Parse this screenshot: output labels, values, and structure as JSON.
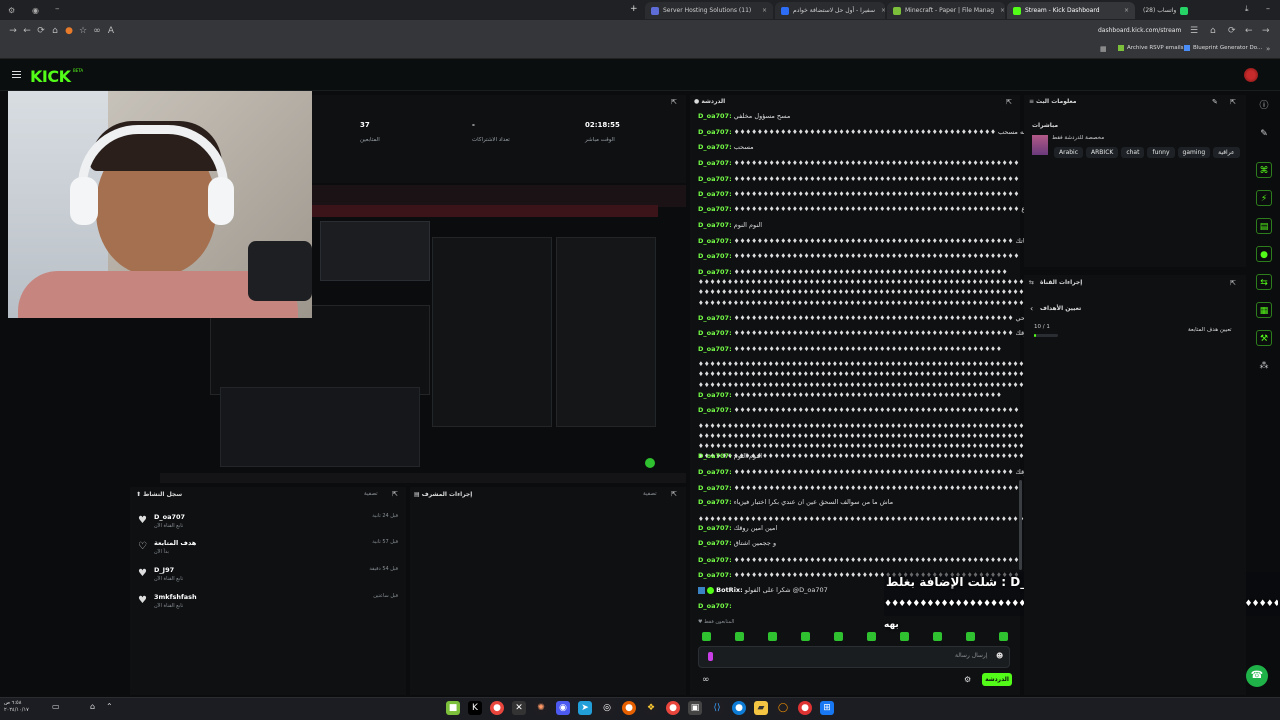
{
  "browser": {
    "tabs": [
      {
        "label": "Server Hosting Solutions (11)",
        "fav": "#5e6cd8"
      },
      {
        "label": "سفيرا - أول حل لاستضافة خوادم",
        "fav": "#2d6df6"
      },
      {
        "label": "Minecraft - Paper | File Manag",
        "fav": "#7bbf3a"
      },
      {
        "label": "Stream - Kick Dashboard",
        "fav": "#53fc18"
      },
      {
        "label": "(28) واتساب",
        "fav": "#25d366"
      }
    ],
    "url": "dashboard.kick.com/stream",
    "bookmarks": [
      "Archive RSVP emails",
      "Blueprint Generator Do..."
    ]
  },
  "kick": {
    "logo": "KICK",
    "beta": "BETA"
  },
  "stats": [
    {
      "value": "37",
      "label": "المتابعين"
    },
    {
      "value": "-",
      "label": "تعداد الاشتراكات"
    },
    {
      "value": "02:18:55",
      "label": "الوقت مباشر"
    }
  ],
  "chat": {
    "title": "الدردشة",
    "lines": [
      {
        "user": "D_oa707:",
        "msg": "مسح مسؤول مخلفي"
      },
      {
        "user": "D_oa707:",
        "msg": "♦♦♦♦♦♦♦♦♦♦♦♦♦♦♦♦♦♦♦♦♦♦♦♦♦♦♦♦♦♦♦♦♦♦♦♦♦♦♦♦♦♦♦♦♦ بابوي اسمه مسحب"
      },
      {
        "user": "D_oa707:",
        "msg": "مسحب"
      },
      {
        "user": "D_oa707:",
        "msg": "♦♦♦♦♦♦♦♦♦♦♦♦♦♦♦♦♦♦♦♦♦♦♦♦♦♦♦♦♦♦♦♦♦♦♦♦♦♦♦♦♦♦♦♦♦♦♦♦♦"
      },
      {
        "user": "D_oa707:",
        "msg": "♦♦♦♦♦♦♦♦♦♦♦♦♦♦♦♦♦♦♦♦♦♦♦♦♦♦♦♦♦♦♦♦♦♦♦♦♦♦♦♦♦♦♦♦♦♦♦♦♦"
      },
      {
        "user": "D_oa707:",
        "msg": "♦♦♦♦♦♦♦♦♦♦♦♦♦♦♦♦♦♦♦♦♦♦♦♦♦♦♦♦♦♦♦♦♦♦♦♦♦♦♦♦♦♦♦♦♦♦♦♦♦"
      },
      {
        "user": "D_oa707:",
        "msg": "♦♦♦♦♦♦♦♦♦♦♦♦♦♦♦♦♦♦♦♦♦♦♦♦♦♦♦♦♦♦♦♦♦♦♦♦♦♦♦♦♦♦♦♦♦♦♦♦♦ سلكت الرجال اللي ما اصرع"
      },
      {
        "user": "D_oa707:",
        "msg": "النوم النوم"
      },
      {
        "user": "D_oa707:",
        "msg": "♦♦♦♦♦♦♦♦♦♦♦♦♦♦♦♦♦♦♦♦♦♦♦♦♦♦♦♦♦♦♦♦♦♦♦♦♦♦♦♦♦♦♦♦♦♦♦♦ النوم لاحياتك"
      },
      {
        "user": "D_oa707:",
        "msg": "♦♦♦♦♦♦♦♦♦♦♦♦♦♦♦♦♦♦♦♦♦♦♦♦♦♦♦♦♦♦♦♦♦♦♦♦♦♦♦♦♦♦♦♦♦♦♦♦♦"
      },
      {
        "user": "D_oa707:",
        "msg": "♦♦♦♦♦♦♦♦♦♦♦♦♦♦♦♦♦♦♦♦♦♦♦♦♦♦♦♦♦♦♦♦♦♦♦♦♦♦♦♦♦♦♦♦♦♦♦"
      }
    ],
    "lines2": [
      {
        "user": "D_oa707:",
        "msg": "♦♦♦♦♦♦♦♦♦♦♦♦♦♦♦♦♦♦♦♦♦♦♦♦♦♦♦♦♦♦♦♦♦♦♦♦♦♦♦♦♦♦♦♦♦♦♦♦ يحي لا احد يستحي"
      },
      {
        "user": "D_oa707:",
        "msg": "♦♦♦♦♦♦♦♦♦♦♦♦♦♦♦♦♦♦♦♦♦♦♦♦♦♦♦♦♦♦♦♦♦♦♦♦♦♦♦♦♦♦♦♦♦♦♦♦ كلش روقك"
      },
      {
        "user": "D_oa707:",
        "msg": "♦♦♦♦♦♦♦♦♦♦♦♦♦♦♦♦♦♦♦♦♦♦♦♦♦♦♦♦♦♦♦♦♦♦♦♦♦♦♦♦♦♦♦♦♦♦"
      },
      {
        "user": "D_oa707:",
        "msg": "♦♦♦♦♦♦♦♦♦♦♦♦♦♦♦♦♦♦♦♦♦♦♦♦♦♦♦♦♦♦♦♦♦♦♦♦♦♦♦♦♦♦♦♦♦♦♦♦♦"
      },
      {
        "user": "D_oa707:",
        "msg": "♦♦♦♦♦♦♦♦♦♦♦♦♦♦♦♦♦♦♦♦♦♦♦♦♦♦♦♦♦♦♦♦♦♦♦♦♦♦♦♦♦♦♦♦♦♦"
      },
      {
        "user": "D_oa707:",
        "msg": "النوم النوم"
      },
      {
        "user": "D_oa707:",
        "msg": "♦♦♦♦♦♦♦♦♦♦♦♦♦♦♦♦♦♦♦♦♦♦♦♦♦♦♦♦♦♦♦♦♦♦♦♦♦♦♦♦♦♦♦♦♦♦♦♦ روقك روقك"
      },
      {
        "user": "D_oa707:",
        "msg": "♦♦♦♦♦♦♦♦♦♦♦♦♦♦♦♦♦♦♦♦♦♦♦♦♦♦♦♦♦♦♦♦♦♦♦♦♦♦♦♦♦♦♦♦♦♦♦♦♦"
      },
      {
        "user": "D_oa707:",
        "msg": "ماش ما من سوالف السحق عين ان عندي بكرا اختبار فيزياء"
      },
      {
        "user": "D_oa707:",
        "msg": "امين امين روقك"
      },
      {
        "user": "D_oa707:",
        "msg": "و ججمين اشتاق"
      },
      {
        "user": "D_oa707:",
        "msg": "♦♦♦♦♦♦♦♦♦♦♦♦♦♦♦♦♦♦♦♦♦♦♦♦♦♦♦♦♦♦♦♦♦♦♦♦♦♦♦♦♦♦♦♦♦♦♦♦♦"
      },
      {
        "user": "D_oa707:",
        "msg": "♦♦♦♦♦♦♦♦♦♦♦♦♦♦♦♦♦♦♦♦♦♦♦♦♦♦♦♦♦♦♦♦♦♦♦♦♦♦♦♦♦♦♦♦♦♦♦♦♦"
      }
    ],
    "bot_user": "BotRix:",
    "bot_msg": "شكرا على الفولو @D_oa707",
    "last_user": "D_oa707:",
    "followers_only": "المتابعون فقط",
    "input_placeholder": "إرسال رسالة",
    "send_label": "الدردشة",
    "overlay_title": "شلت الإضافة بغلط : D_oa707",
    "overlay_glyph": "بهه"
  },
  "stream_info": {
    "title": "معلومات البث",
    "sub": "مباشرات",
    "channel": "مخصصة للدردشة فقط",
    "tags": [
      "Arabic",
      "ARBICK",
      "chat",
      "funny",
      "gaming",
      "عراقية"
    ]
  },
  "channel_actions": {
    "title": "إجراءات القناة",
    "goals": "تعيين الأهداف",
    "goal_label": "تعيين هدف المتابعة",
    "goal_value": "10 / 1",
    "goal_progress": 0.1
  },
  "activity": {
    "title": "سجل النشاط",
    "filter": "تصفية",
    "rows": [
      {
        "name": "D_oa707",
        "sub": "تابع القناة الآن",
        "time": "قبل 24 ثانية"
      },
      {
        "name": "هدف المتابعة",
        "sub": "بدأ الآن",
        "time": "قبل 57 ثانية"
      },
      {
        "name": "D_J97",
        "sub": "تابع القناة الآن",
        "time": "قبل 54 دقيقة"
      },
      {
        "name": "3mkfshfash",
        "sub": "تابع القناة الآن",
        "time": "قبل ساعتين"
      }
    ]
  },
  "mod_actions": {
    "title": "إجراءات المشرف",
    "filter": "تصفية"
  },
  "taskbar": {
    "time": "٦:٥٨ ص",
    "date": "٢٠٢٤/١٠/١٧"
  }
}
